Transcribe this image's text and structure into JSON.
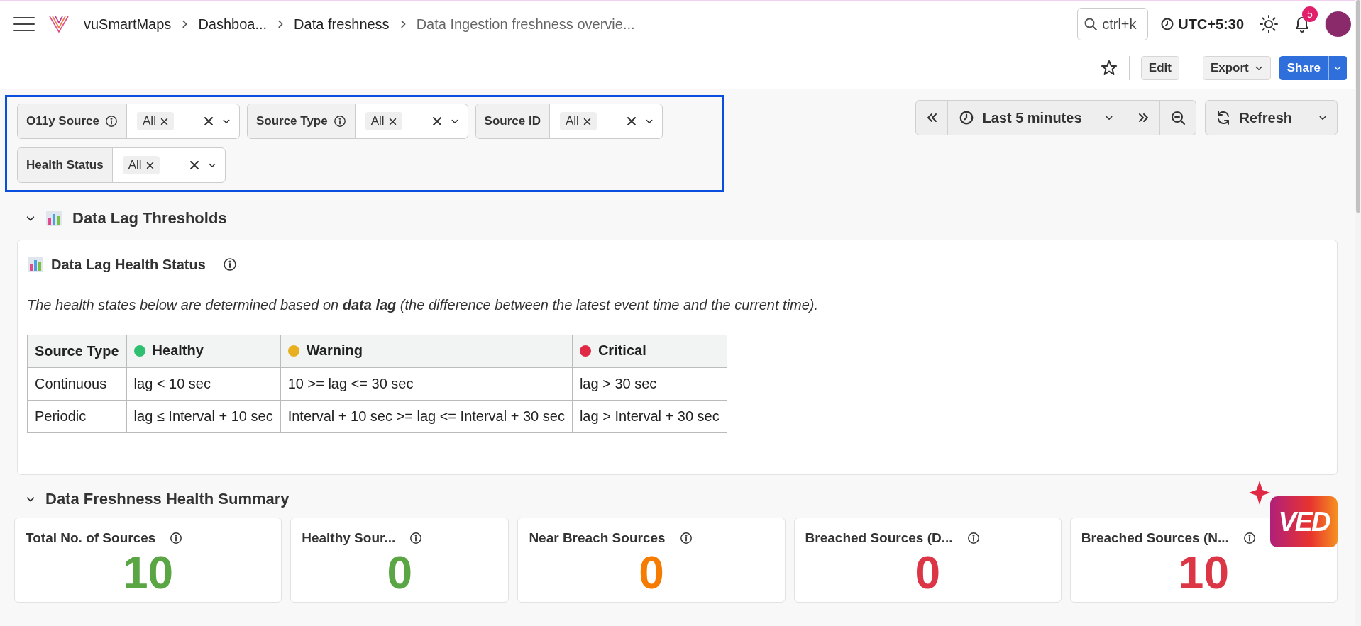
{
  "header": {
    "breadcrumbs": [
      {
        "label": "vuSmartMaps"
      },
      {
        "label": "Dashboa..."
      },
      {
        "label": "Data freshness"
      },
      {
        "label": "Data Ingestion freshness overvie..."
      }
    ],
    "search": {
      "placeholder": "ctrl+k"
    },
    "timezone": "UTC+5:30",
    "notification_count": "5"
  },
  "toolbar": {
    "buttons": [
      {
        "label": "Edit",
        "kind": "plain"
      },
      {
        "label": "Export",
        "kind": "dropdown"
      },
      {
        "label": "Share",
        "kind": "split"
      }
    ]
  },
  "filters": [
    {
      "label": "O11y Source",
      "info": true,
      "value": "All"
    },
    {
      "label": "Source Type",
      "info": true,
      "value": "All"
    },
    {
      "label": "Source ID",
      "info": false,
      "value": "All"
    },
    {
      "label": "Health Status",
      "info": false,
      "value": "All"
    }
  ],
  "time_controls": {
    "range": "Last 5 minutes",
    "refresh": "Refresh"
  },
  "thresholds": {
    "title": "Data Lag Thresholds",
    "expanded": true,
    "panel": {
      "title": "Data Lag Health Status",
      "description": "The health states below are determined based on **data lag** (the difference between the latest event time and the current time).",
      "table": {
        "columns": [
          {
            "label": "Source Type"
          },
          {
            "label": "Healthy",
            "color": "#2fbf71"
          },
          {
            "label": "Warning",
            "color": "#e8b020"
          },
          {
            "label": "Critical",
            "color": "#e02a45"
          }
        ],
        "rows": [
          [
            "Continuous",
            "lag < 10 sec",
            "10 >= lag <= 30 sec",
            "lag > 30 sec"
          ],
          [
            "Periodic",
            "lag ≤ Interval + 10 sec",
            "Interval + 10 sec >= lag <= Interval + 30 sec",
            "lag > Interval + 30 sec"
          ]
        ]
      }
    }
  },
  "summary": {
    "title": "Data Freshness Health Summary",
    "expanded": true,
    "cards": [
      {
        "title": "Total No. of Sources",
        "value": "10",
        "color": "#5aa544"
      },
      {
        "title": "Healthy Sour...",
        "value": "0",
        "color": "#5aa544"
      },
      {
        "title": "Near Breach Sources",
        "value": "0",
        "color": "#f57c00"
      },
      {
        "title": "Breached Sources (D...",
        "value": "0",
        "color": "#dc3545"
      },
      {
        "title": "Breached Sources (N...",
        "value": "10",
        "color": "#dc3545"
      }
    ]
  },
  "assistant_logo": "VED"
}
